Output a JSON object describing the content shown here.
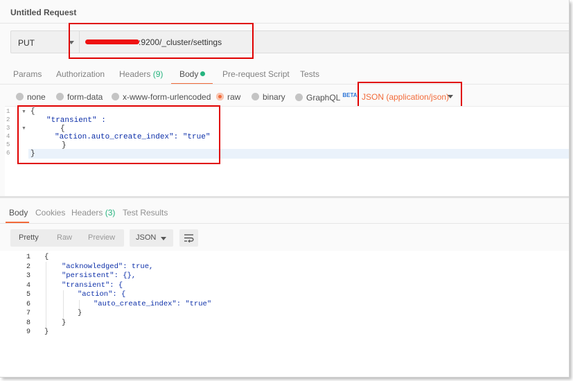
{
  "window": {
    "title": "Untitled Request"
  },
  "request": {
    "method": "PUT",
    "url_visible": ":9200/_cluster/settings"
  },
  "request_tabs": [
    {
      "label": "Params"
    },
    {
      "label": "Authorization"
    },
    {
      "label": "Headers",
      "count": "(9)"
    },
    {
      "label": "Body",
      "active": true
    },
    {
      "label": "Pre-request Script"
    },
    {
      "label": "Tests"
    }
  ],
  "body_modes": [
    {
      "label": "none"
    },
    {
      "label": "form-data"
    },
    {
      "label": "x-www-form-urlencoded"
    },
    {
      "label": "raw",
      "selected": true
    },
    {
      "label": "binary"
    },
    {
      "label": "GraphQL",
      "badge": "BETA"
    }
  ],
  "content_type": "JSON (application/json)",
  "request_body": {
    "line_numbers": [
      "1",
      "2",
      "3",
      "4",
      "5",
      "6"
    ],
    "lines": [
      "{",
      "\"transient\" :",
      "{",
      "\"action.auto_create_index\": \"true\"",
      "}",
      "}"
    ]
  },
  "response_tabs": [
    {
      "label": "Body",
      "active": true
    },
    {
      "label": "Cookies"
    },
    {
      "label": "Headers",
      "count": "(3)"
    },
    {
      "label": "Test Results"
    }
  ],
  "response_view": {
    "modes": [
      "Pretty",
      "Raw",
      "Preview"
    ],
    "active_mode": "Pretty",
    "format": "JSON"
  },
  "response_body": {
    "line_numbers": [
      "1",
      "2",
      "3",
      "4",
      "5",
      "6",
      "7",
      "8",
      "9"
    ],
    "lines": [
      "{",
      "\"acknowledged\": true,",
      "\"persistent\": {},",
      "\"transient\": {",
      "\"action\": {",
      "\"auto_create_index\": \"true\"",
      "}",
      "}",
      "}"
    ]
  },
  "colors": {
    "accent": "#f26b3a",
    "count_green": "#26b47f",
    "annotation_red": "#e00000",
    "json_blue": "#0b2ea8"
  },
  "icons": {
    "method_dropdown": "chevron-down-icon",
    "content_type_dropdown": "chevron-down-icon",
    "wrap": "wrap-lines-icon"
  }
}
